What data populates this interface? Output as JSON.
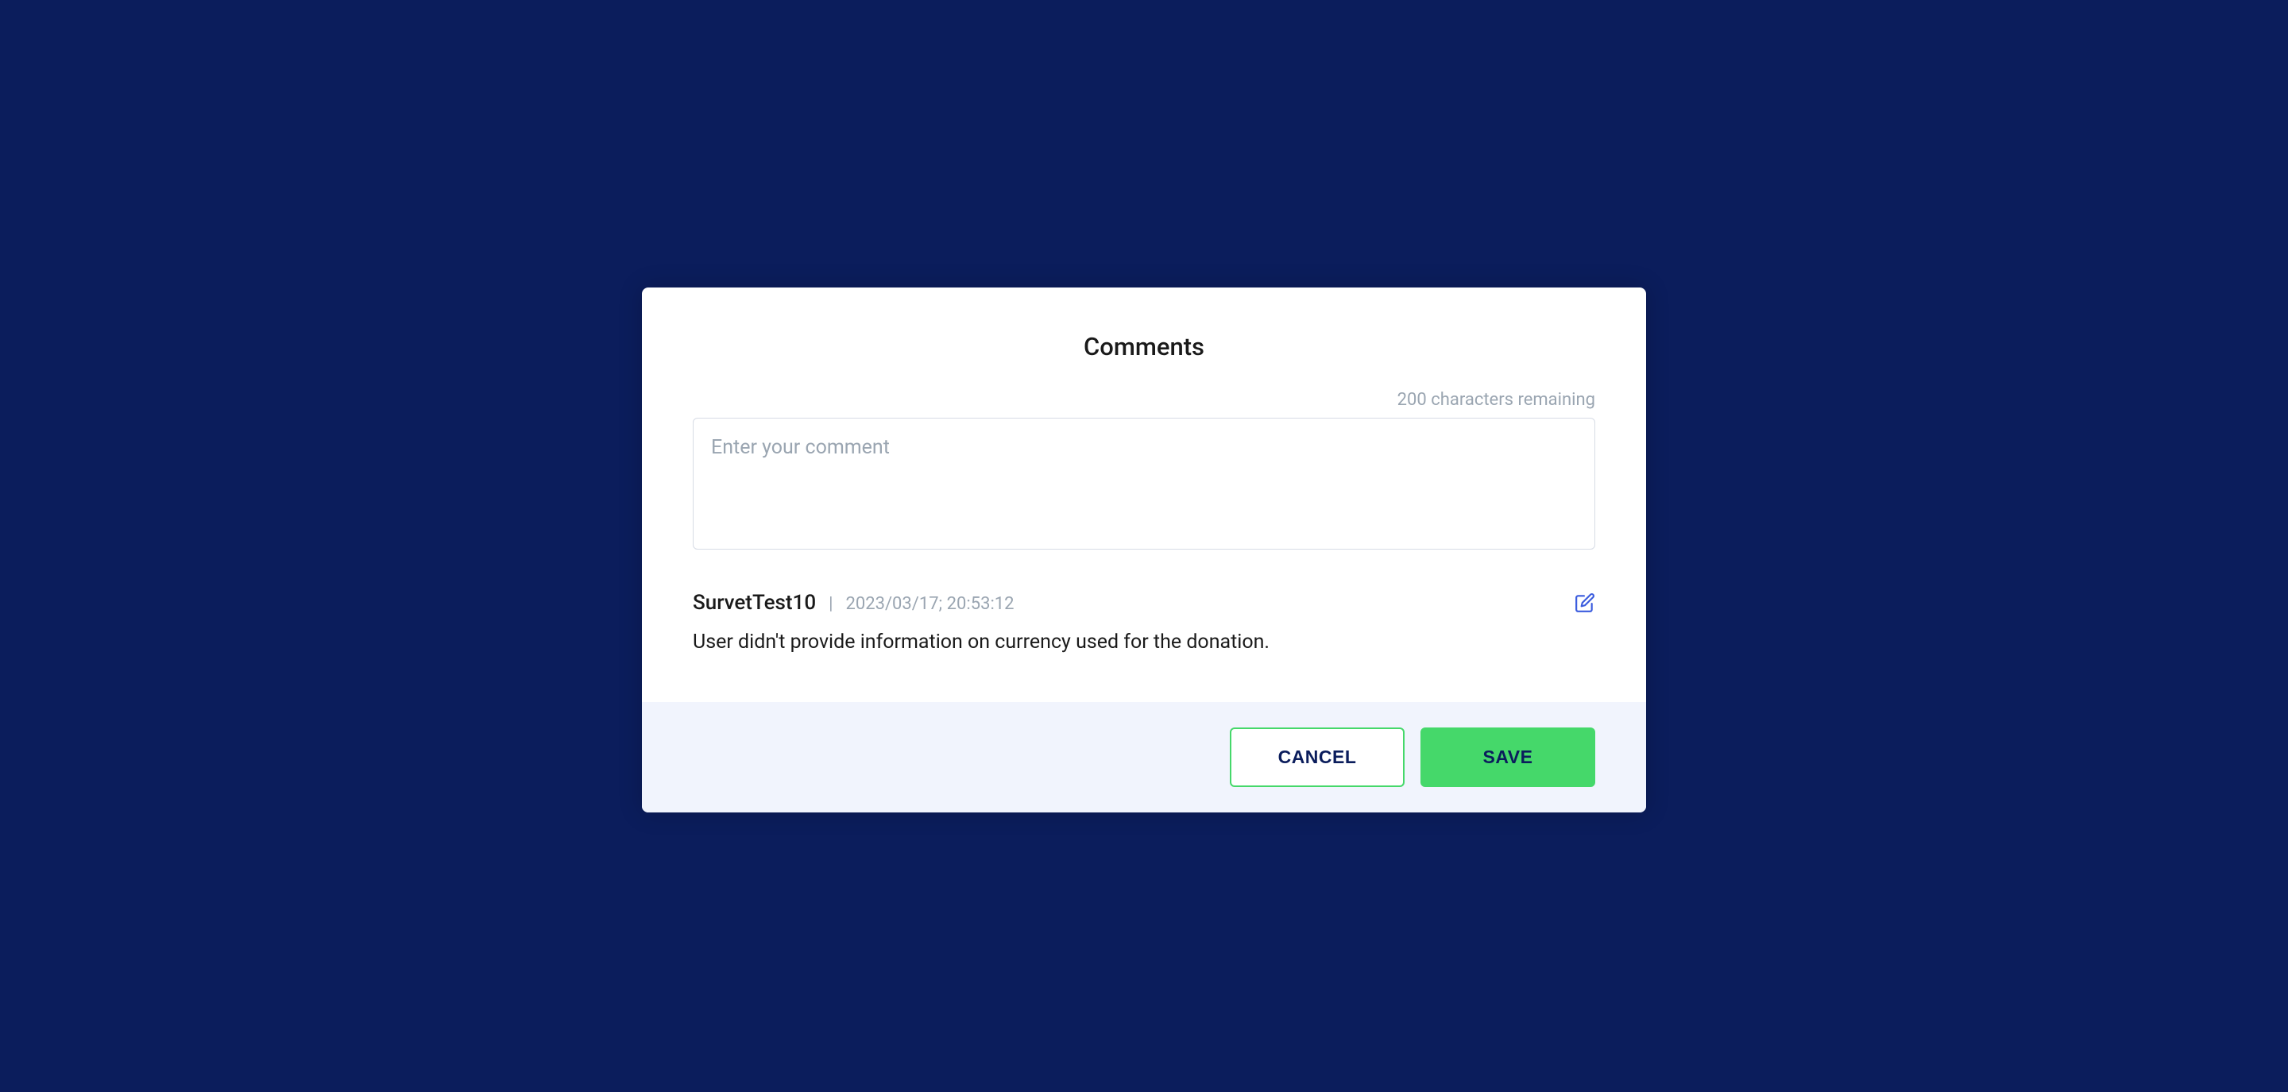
{
  "modal": {
    "title": "Comments",
    "charCounter": "200 characters remaining",
    "inputPlaceholder": "Enter your comment",
    "existingComment": {
      "author": "SurvetTest10",
      "separator": "|",
      "timestamp": "2023/03/17; 20:53:12",
      "body": "User didn't provide information on currency used for the donation."
    },
    "buttons": {
      "cancel": "CANCEL",
      "save": "SAVE"
    }
  }
}
